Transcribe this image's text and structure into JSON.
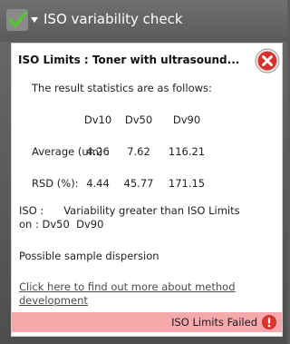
{
  "header": {
    "title": "ISO variability check",
    "status_icon": "check-icon",
    "expand_icon": "chevron-down-icon"
  },
  "panel": {
    "title": "ISO Limits : Toner with ultrasound...",
    "close_icon": "close-icon",
    "intro": "The result statistics are as follows:",
    "columns": [
      "Dv10",
      "Dv50",
      "Dv90"
    ],
    "rows": [
      {
        "label": "Average (um) :",
        "values": [
          "4.26",
          "7.62",
          "116.21"
        ]
      },
      {
        "label": "RSD (%):",
        "values": [
          "4.44",
          "45.77",
          "171.15"
        ]
      }
    ],
    "iso_line1": "ISO :      Variability greater than ISO Limits",
    "iso_line2": "on : Dv50  Dv90",
    "note": "Possible sample dispersion",
    "link_text": "Click here to find out more about method development",
    "status_text": "ISO Limits Failed",
    "status_icon": "alert-icon"
  },
  "colors": {
    "status_bar": "#f5a9ab",
    "check_green": "#5cc13a",
    "close_red": "#d8302b",
    "alert_red": "#e0352b"
  }
}
